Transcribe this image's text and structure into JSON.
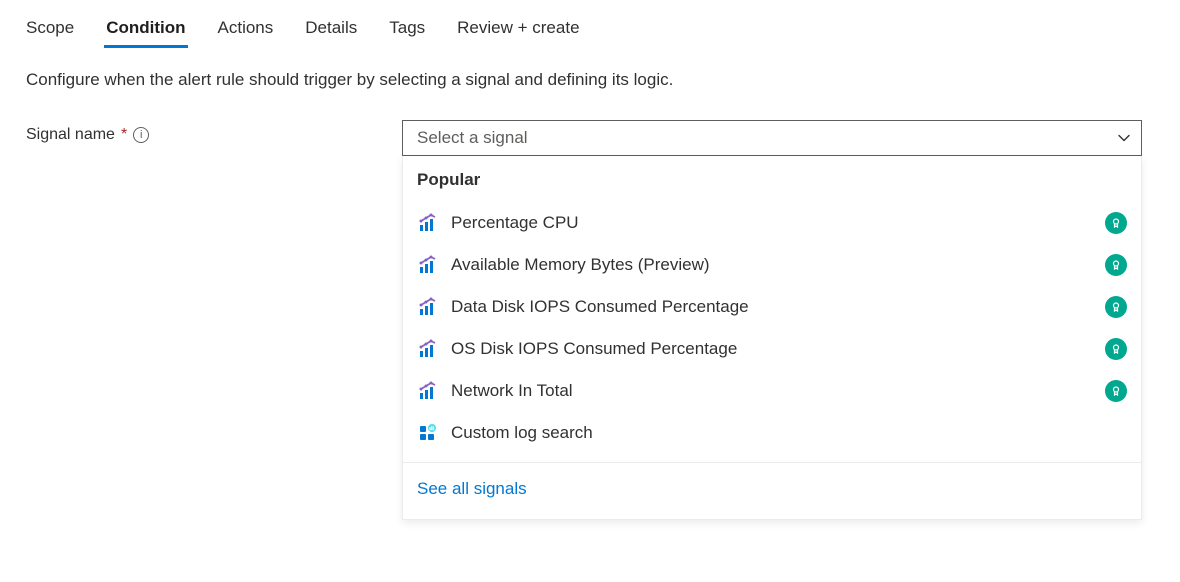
{
  "tabs": {
    "items": [
      {
        "label": "Scope",
        "active": false
      },
      {
        "label": "Condition",
        "active": true
      },
      {
        "label": "Actions",
        "active": false
      },
      {
        "label": "Details",
        "active": false
      },
      {
        "label": "Tags",
        "active": false
      },
      {
        "label": "Review + create",
        "active": false
      }
    ]
  },
  "description": "Configure when the alert rule should trigger by selecting a signal and defining its logic.",
  "field": {
    "label": "Signal name",
    "required_marker": "*",
    "info_glyph": "i",
    "placeholder": "Select a signal"
  },
  "dropdown": {
    "header": "Popular",
    "signals": [
      {
        "label": "Percentage CPU",
        "icon": "metric",
        "badge": true
      },
      {
        "label": "Available Memory Bytes (Preview)",
        "icon": "metric",
        "badge": true
      },
      {
        "label": "Data Disk IOPS Consumed Percentage",
        "icon": "metric",
        "badge": true
      },
      {
        "label": "OS Disk IOPS Consumed Percentage",
        "icon": "metric",
        "badge": true
      },
      {
        "label": "Network In Total",
        "icon": "metric",
        "badge": true
      },
      {
        "label": "Custom log search",
        "icon": "log",
        "badge": false
      }
    ],
    "see_all": "See all signals"
  }
}
